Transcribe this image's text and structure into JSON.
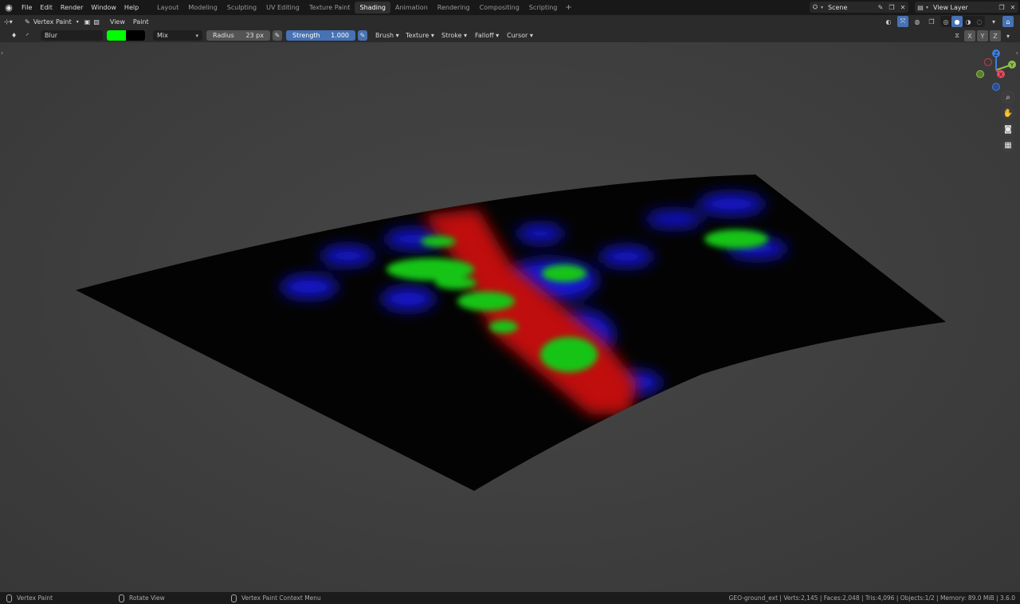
{
  "menu": [
    "File",
    "Edit",
    "Render",
    "Window",
    "Help"
  ],
  "workspaces": [
    "Layout",
    "Modeling",
    "Sculpting",
    "UV Editing",
    "Texture Paint",
    "Shading",
    "Animation",
    "Rendering",
    "Compositing",
    "Scripting"
  ],
  "active_workspace": "Shading",
  "add_workspace": "+",
  "scene": "Scene",
  "view_layer": "View Layer",
  "header": {
    "mode": "Vertex Paint",
    "view": "View",
    "paint": "Paint"
  },
  "tool": {
    "brush_name": "Blur",
    "color_primary": "#00ff00",
    "color_secondary": "#000000",
    "blend": "Mix",
    "radius_label": "Radius",
    "radius_value": "23 px",
    "strength_label": "Strength",
    "strength_value": "1.000",
    "popovers": [
      "Brush",
      "Texture",
      "Stroke",
      "Falloff",
      "Cursor"
    ]
  },
  "mirror_axes": [
    "X",
    "Y",
    "Z"
  ],
  "gizmo": {
    "x": "X",
    "y": "Y",
    "z": "Z"
  },
  "status": {
    "left_action": "Vertex Paint",
    "middle_action": "Rotate View",
    "right_action": "Vertex Paint Context Menu",
    "info": "GEO-ground_ext | Verts:2,145 | Faces:2,048 | Tris:4,096 | Objects:1/2 | Memory: 89.0 MiB | 3.6.0"
  },
  "colors": {
    "accent": "#4772b3",
    "axis_x": "#e84a5f",
    "axis_y": "#8bc34a",
    "axis_z": "#3f7de0"
  }
}
